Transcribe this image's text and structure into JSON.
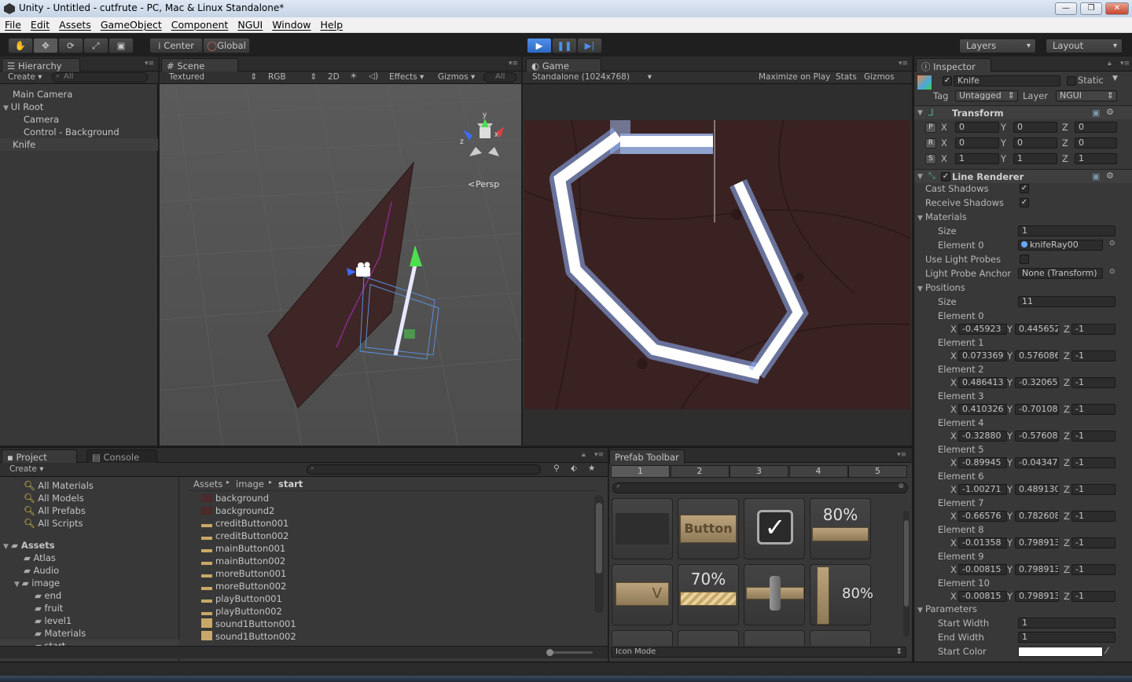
{
  "window": {
    "title": "Unity - Untitled - cutfrute - PC, Mac & Linux Standalone*",
    "controls": [
      "—",
      "❐",
      "✕"
    ]
  },
  "menu": [
    "File",
    "Edit",
    "Assets",
    "GameObject",
    "Component",
    "NGUI",
    "Window",
    "Help"
  ],
  "toolbar": {
    "pivot": "Center",
    "space": "Global",
    "layers": "Layers",
    "layout": "Layout"
  },
  "hierarchy": {
    "tab": "Hierarchy",
    "create": "Create",
    "search_placeholder": "All",
    "items": [
      {
        "label": "Main Camera",
        "indent": 0
      },
      {
        "label": "UI Root",
        "indent": 0,
        "expanded": true
      },
      {
        "label": "Camera",
        "indent": 1
      },
      {
        "label": "Control - Background",
        "indent": 1
      },
      {
        "label": "Knife",
        "indent": 0,
        "selected": true
      }
    ]
  },
  "scene": {
    "tab": "Scene",
    "shading": "Textured",
    "render": "RGB",
    "mode2d": "2D",
    "effects": "Effects",
    "gizmos": "Gizmos",
    "search_placeholder": "All",
    "persp": "Persp",
    "axis_x": "x",
    "axis_y": "y",
    "axis_z": "z"
  },
  "game": {
    "tab": "Game",
    "resolution": "Standalone (1024x768)",
    "maximize": "Maximize on Play",
    "stats": "Stats",
    "gizmos": "Gizmos"
  },
  "inspector": {
    "tab": "Inspector",
    "name": "Knife",
    "static": "Static",
    "tag_label": "Tag",
    "tag": "Untagged",
    "layer_label": "Layer",
    "layer": "NGUI",
    "transform": {
      "title": "Transform",
      "rows": [
        {
          "btn": "P",
          "x": "0",
          "y": "0",
          "z": "0"
        },
        {
          "btn": "R",
          "x": "0",
          "y": "0",
          "z": "0"
        },
        {
          "btn": "S",
          "x": "1",
          "y": "1",
          "z": "1"
        }
      ]
    },
    "line_renderer": {
      "title": "Line Renderer",
      "cast_shadows": "Cast Shadows",
      "receive_shadows": "Receive Shadows",
      "materials": "Materials",
      "size_label": "Size",
      "materials_size": "1",
      "element0_label": "Element 0",
      "element0": "knifeRay00",
      "use_light_probes": "Use Light Probes",
      "light_probe_anchor": "Light Probe Anchor",
      "anchor_value": "None (Transform)",
      "positions": "Positions",
      "positions_size": "11",
      "elements": [
        {
          "label": "Element 0",
          "x": "-0.45923",
          "y": "0.445652",
          "z": "-1"
        },
        {
          "label": "Element 1",
          "x": "0.073369",
          "y": "0.576086",
          "z": "-1"
        },
        {
          "label": "Element 2",
          "x": "0.486413",
          "y": "-0.32065",
          "z": "-1"
        },
        {
          "label": "Element 3",
          "x": "0.410326",
          "y": "-0.70108",
          "z": "-1"
        },
        {
          "label": "Element 4",
          "x": "-0.32880",
          "y": "-0.57608",
          "z": "-1"
        },
        {
          "label": "Element 5",
          "x": "-0.89945",
          "y": "-0.04347",
          "z": "-1"
        },
        {
          "label": "Element 6",
          "x": "-1.00271",
          "y": "0.489130",
          "z": "-1"
        },
        {
          "label": "Element 7",
          "x": "-0.66576",
          "y": "0.782608",
          "z": "-1"
        },
        {
          "label": "Element 8",
          "x": "-0.01358",
          "y": "0.798913",
          "z": "-1"
        },
        {
          "label": "Element 9",
          "x": "-0.00815",
          "y": "0.798913",
          "z": "-1"
        },
        {
          "label": "Element 10",
          "x": "-0.00815",
          "y": "0.798913",
          "z": "-1"
        }
      ],
      "parameters": "Parameters",
      "start_width_label": "Start Width",
      "start_width": "1",
      "end_width_label": "End Width",
      "end_width": "1",
      "start_color_label": "Start Color"
    }
  },
  "project": {
    "tab": "Project",
    "console_tab": "Console",
    "create": "Create",
    "favorites": [
      "All Materials",
      "All Models",
      "All Prefabs",
      "All Scripts"
    ],
    "assets_label": "Assets",
    "folders": [
      {
        "label": "Atlas",
        "indent": 1
      },
      {
        "label": "Audio",
        "indent": 1
      },
      {
        "label": "image",
        "indent": 1,
        "expanded": true
      },
      {
        "label": "end",
        "indent": 2
      },
      {
        "label": "fruit",
        "indent": 2
      },
      {
        "label": "level1",
        "indent": 2
      },
      {
        "label": "Materials",
        "indent": 2
      },
      {
        "label": "start",
        "indent": 2,
        "selected": true
      }
    ],
    "breadcrumb": [
      "Assets",
      "image",
      "start"
    ],
    "files": [
      "background",
      "background2",
      "creditButton001",
      "creditButton002",
      "mainButton001",
      "mainButton002",
      "moreButton001",
      "moreButton002",
      "playButton001",
      "playButton002",
      "sound1Button001",
      "sound1Button002"
    ]
  },
  "prefab": {
    "tab": "Prefab Toolbar",
    "pages": [
      "1",
      "2",
      "3",
      "4",
      "5"
    ],
    "button_label": "Button",
    "bar80": "80%",
    "bar70": "70%",
    "v_label": "V",
    "icon_mode": "Icon Mode"
  },
  "colors": {
    "accent": "#3d7bd6",
    "game_bg": "#3a2222",
    "selection": "#3e3e3e"
  }
}
